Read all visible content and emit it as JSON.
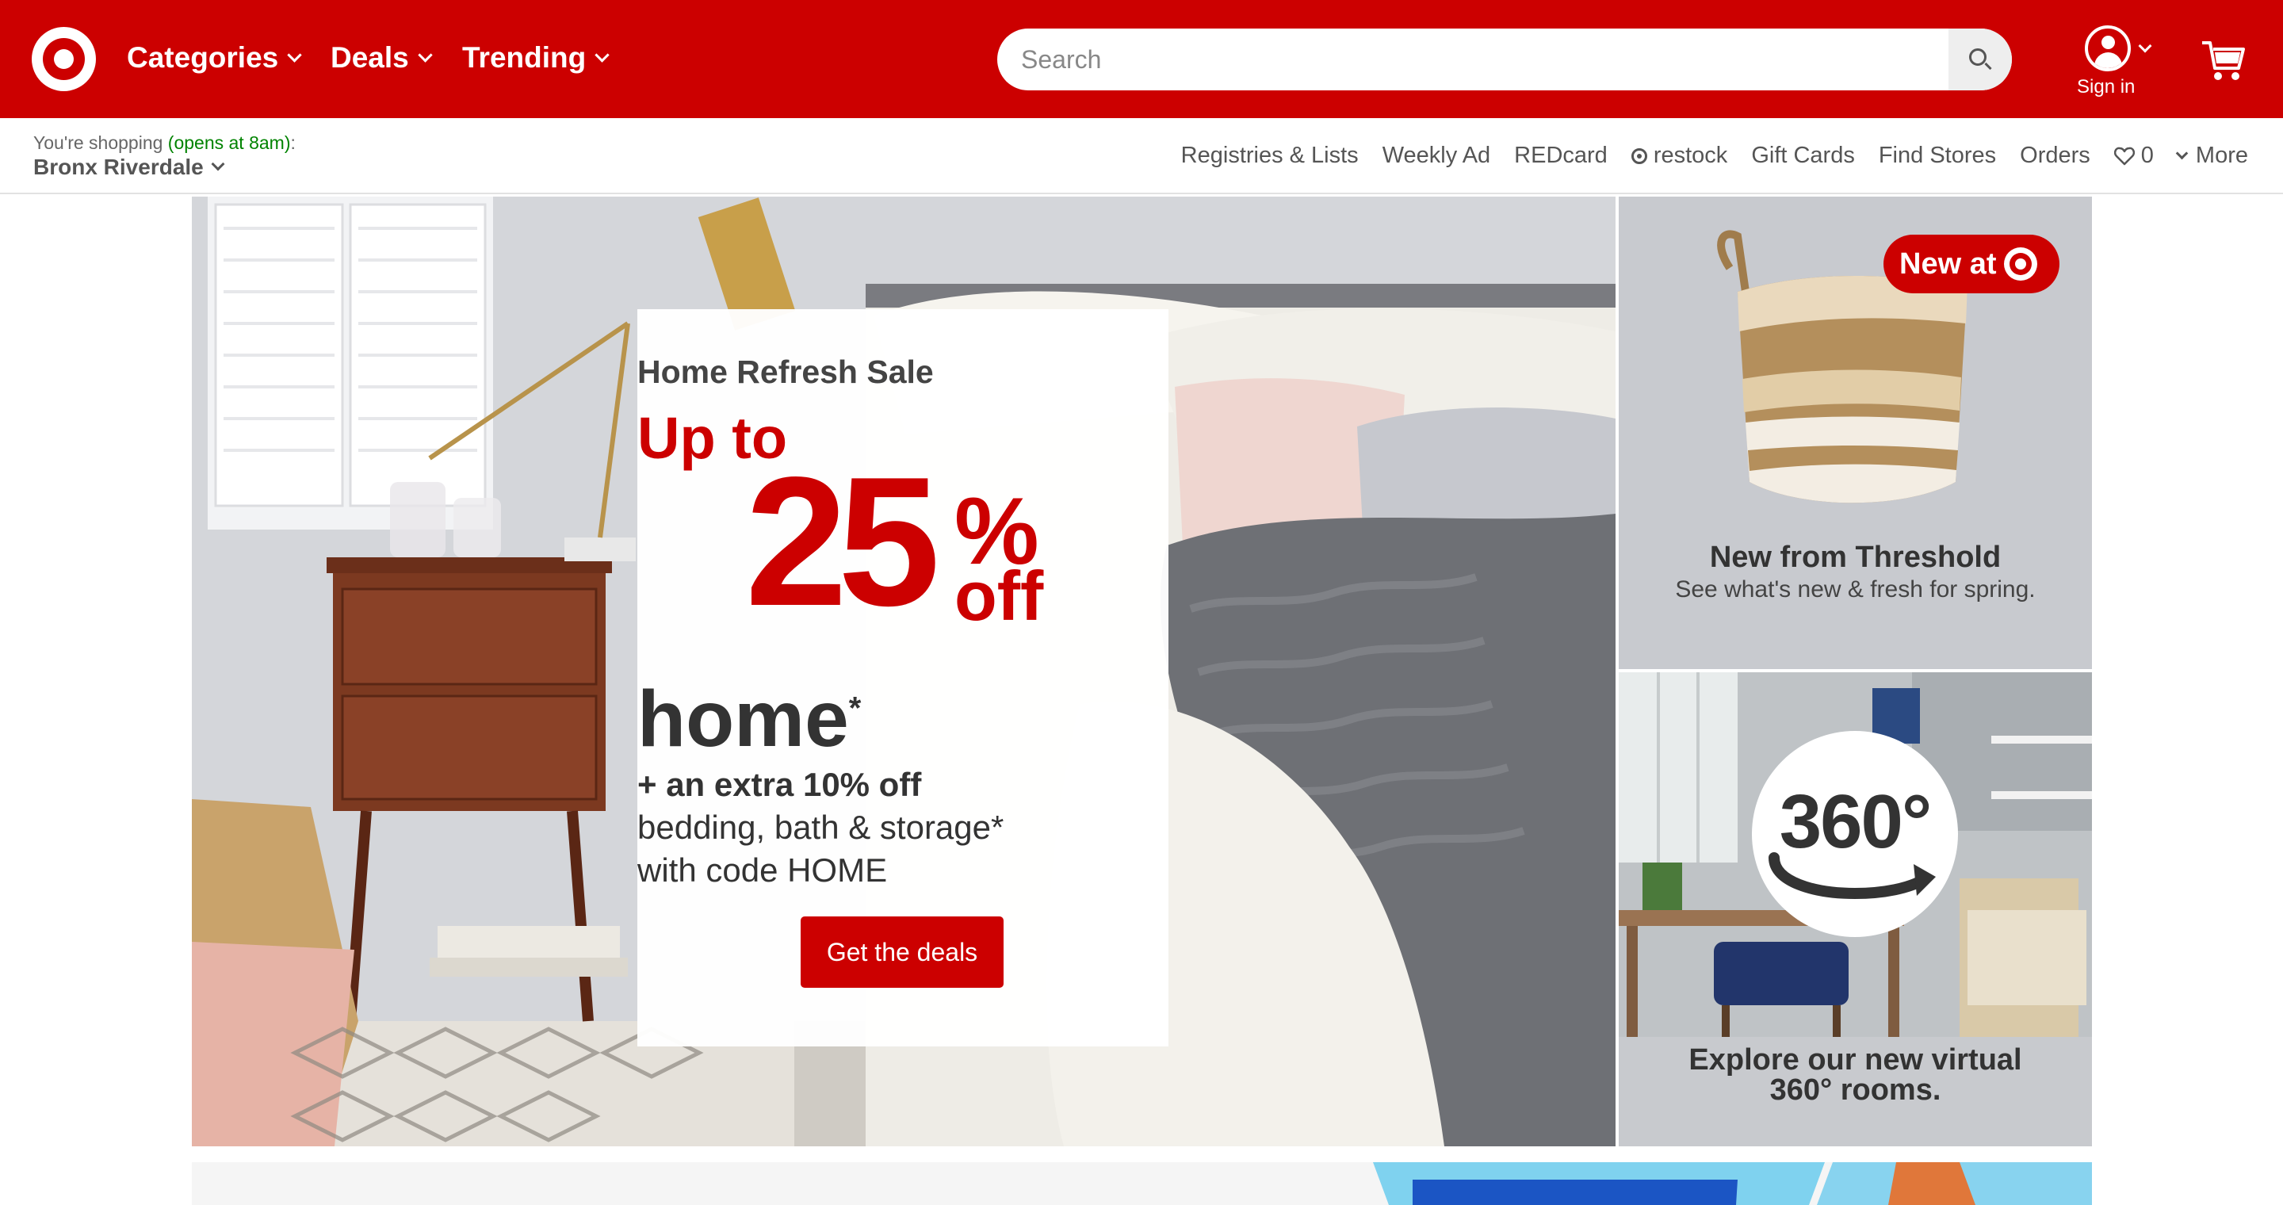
{
  "header": {
    "nav": [
      {
        "label": "Categories"
      },
      {
        "label": "Deals"
      },
      {
        "label": "Trending"
      }
    ],
    "search_placeholder": "Search",
    "signin_label": "Sign in"
  },
  "subbar": {
    "shopping_prefix": "You're shopping ",
    "opens": "(opens at 8am)",
    "shopping_suffix": ":",
    "store": "Bronx Riverdale",
    "links": {
      "registries": "Registries & Lists",
      "weekly_ad": "Weekly Ad",
      "redcard": "REDcard",
      "restock": "restock",
      "gift_cards": "Gift Cards",
      "find_stores": "Find Stores",
      "orders": "Orders",
      "favorites_count": "0",
      "more": "More"
    }
  },
  "hero": {
    "title": "Home Refresh Sale",
    "up_to": "Up to",
    "percent_number": "25",
    "percent_sign": "%",
    "off": "off",
    "home": "home",
    "asterisk": "*",
    "extra": "+ an extra 10% off",
    "line1": "bedding, bath & storage*",
    "line2": "with code HOME",
    "button": "Get the deals"
  },
  "tiles": {
    "threshold": {
      "badge": "New at",
      "title": "New from Threshold",
      "subtitle": "See what's new & fresh for spring."
    },
    "rooms": {
      "badge_text": "360°",
      "title": "Explore our new virtual 360° rooms."
    }
  },
  "colors": {
    "brand_red": "#cc0000",
    "open_green": "#008300"
  }
}
